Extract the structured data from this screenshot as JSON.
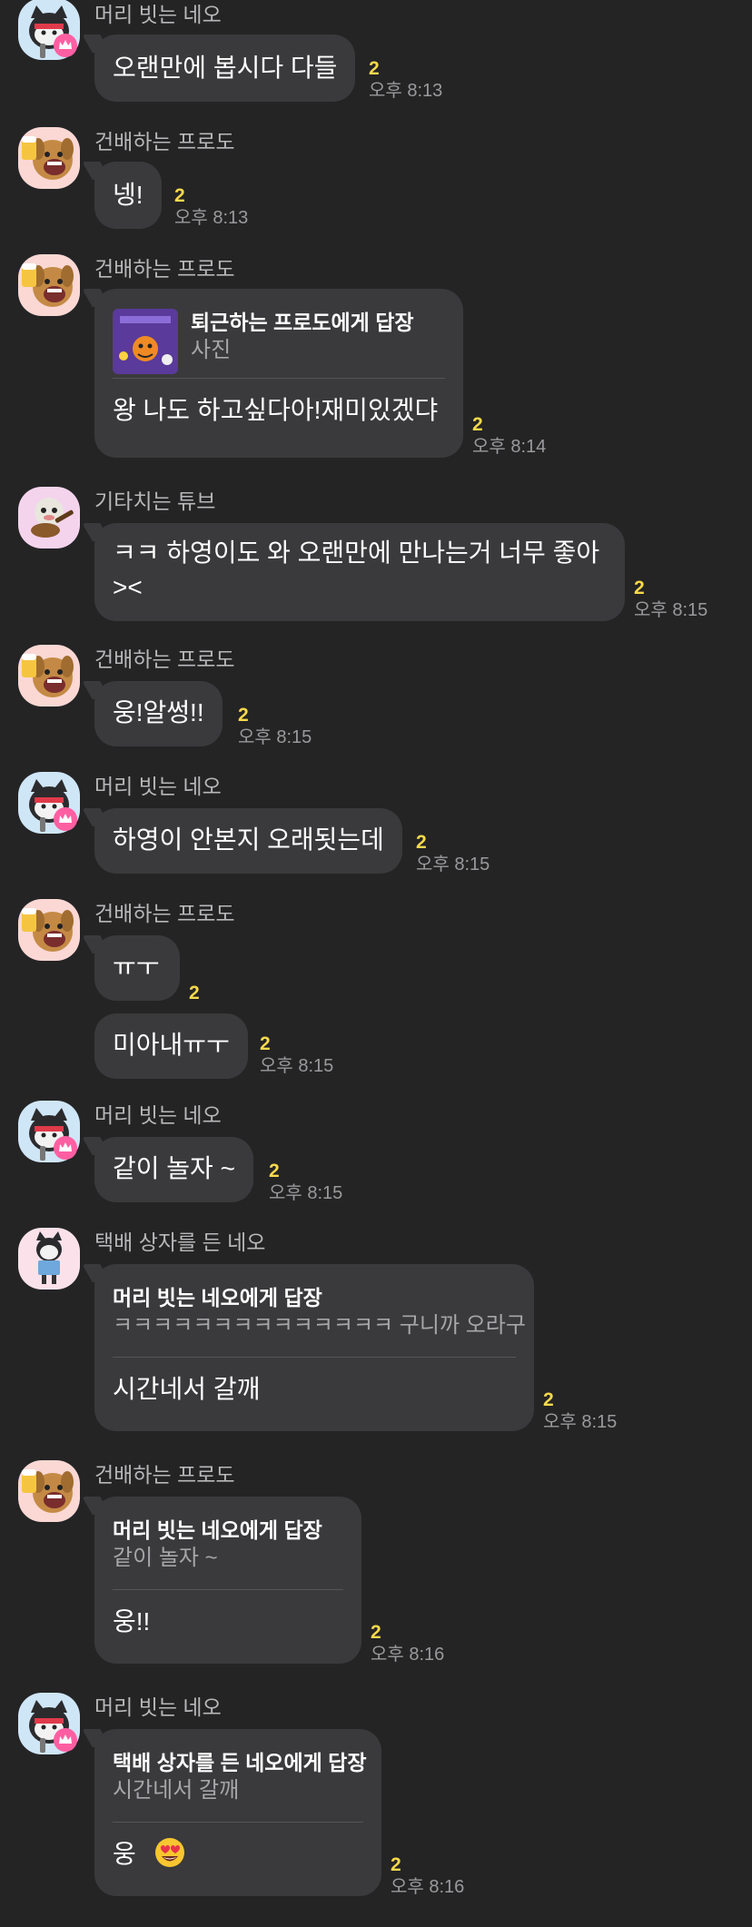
{
  "theme": {
    "background": "#242425",
    "bubble": "#3a3a3c",
    "unread_color": "#f7d94c",
    "time_color": "#9a9a9d",
    "sender_color": "#b8b8ba"
  },
  "messages": [
    {
      "sender": "머리 빗는 네오",
      "avatar": "neo-brushing-icon",
      "text": "오랜만에 봅시다 다들",
      "unread": "2",
      "time": "오후 8:13"
    },
    {
      "sender": "건배하는 프로도",
      "avatar": "frodo-cheers-icon",
      "text": "넹!",
      "unread": "2",
      "time": "오후 8:13"
    },
    {
      "sender": "건배하는 프로도",
      "avatar": "frodo-cheers-icon",
      "reply_to": "퇴근하는 프로도에게 답장",
      "quote": "사진",
      "text": "왕 나도 하고싶다아!재미있겠댜",
      "unread": "2",
      "time": "오후 8:14"
    },
    {
      "sender": "기타치는 튜브",
      "avatar": "tube-guitar-icon",
      "text_line1": "ㅋㅋ 하영이도 와 오랜만에 만나는거 너무 좋아",
      "text_line2": "><",
      "unread": "2",
      "time": "오후 8:15"
    },
    {
      "sender": "건배하는 프로도",
      "avatar": "frodo-cheers-icon",
      "text": "웅!알썽!!",
      "unread": "2",
      "time": "오후 8:15"
    },
    {
      "sender": "머리 빗는 네오",
      "avatar": "neo-brushing-icon",
      "text": "하영이 안본지 오래됫는데",
      "unread": "2",
      "time": "오후 8:15"
    },
    {
      "sender": "건배하는 프로도",
      "avatar": "frodo-cheers-icon",
      "text": "ㅠㅜ",
      "unread": "2",
      "text2": "미아내ㅠㅜ",
      "unread2": "2",
      "time2": "오후 8:15"
    },
    {
      "sender": "머리 빗는 네오",
      "avatar": "neo-brushing-icon",
      "text": "같이 놀자 ~",
      "unread": "2",
      "time": "오후 8:15"
    },
    {
      "sender": "택배 상자를 든 네오",
      "avatar": "neo-box-icon",
      "reply_to": "머리 빗는 네오에게 답장",
      "quote": "ㅋㅋㅋㅋㅋㅋㅋㅋㅋㅋㅋㅋㅋㅋ 구니까 오라구",
      "text": "시간네서 갈깨",
      "unread": "2",
      "time": "오후 8:15"
    },
    {
      "sender": "건배하는 프로도",
      "avatar": "frodo-cheers-icon",
      "reply_to": "머리 빗는 네오에게 답장",
      "quote": "같이 놀자 ~",
      "text": "웅!!",
      "unread": "2",
      "time": "오후 8:16"
    },
    {
      "sender": "머리 빗는 네오",
      "avatar": "neo-brushing-icon",
      "reply_to": "택배 상자를 든 네오에게 답장",
      "quote": "시간네서 갈깨",
      "text": "웅",
      "emoji": "heart-eyes-emoji",
      "unread": "2",
      "time": "오후 8:16"
    }
  ]
}
